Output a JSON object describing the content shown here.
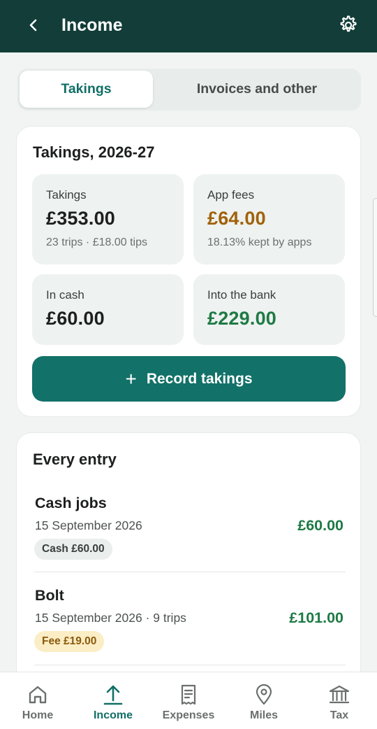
{
  "header": {
    "title": "Income",
    "back_icon": "chevron-left-icon",
    "settings_icon": "gear-icon"
  },
  "tabs": [
    {
      "label": "Takings",
      "active": true
    },
    {
      "label": "Invoices and other",
      "active": false
    }
  ],
  "summary": {
    "title": "Takings, 2026-27",
    "tiles": {
      "takings": {
        "label": "Takings",
        "value": "£353.00",
        "sub": "23 trips · £18.00 tips"
      },
      "app_fees": {
        "label": "App fees",
        "value": "£64.00",
        "sub": "18.13% kept by apps"
      },
      "in_cash": {
        "label": "In cash",
        "value": "£60.00"
      },
      "into_bank": {
        "label": "Into the bank",
        "value": "£229.00"
      }
    },
    "record_button": {
      "icon": "+",
      "label": "Record takings"
    }
  },
  "entries": {
    "title": "Every entry",
    "items": [
      {
        "name": "Cash jobs",
        "meta": "15 September 2026",
        "amount": "£60.00",
        "chip": "Cash £60.00"
      },
      {
        "name": "Bolt",
        "meta": "15 September 2026 · 9 trips",
        "amount": "£101.00",
        "chip": "Fee £19.00"
      }
    ]
  },
  "nav": [
    {
      "label": "Home",
      "icon": "home-icon",
      "active": false
    },
    {
      "label": "Income",
      "icon": "upload-icon",
      "active": true
    },
    {
      "label": "Expenses",
      "icon": "receipt-icon",
      "active": false
    },
    {
      "label": "Miles",
      "icon": "location-pin-icon",
      "active": false
    },
    {
      "label": "Tax",
      "icon": "bank-icon",
      "active": false
    }
  ],
  "colors": {
    "header": "#123d39",
    "accent": "#127168",
    "positive": "#1e7a45",
    "fee": "#a0620a"
  }
}
